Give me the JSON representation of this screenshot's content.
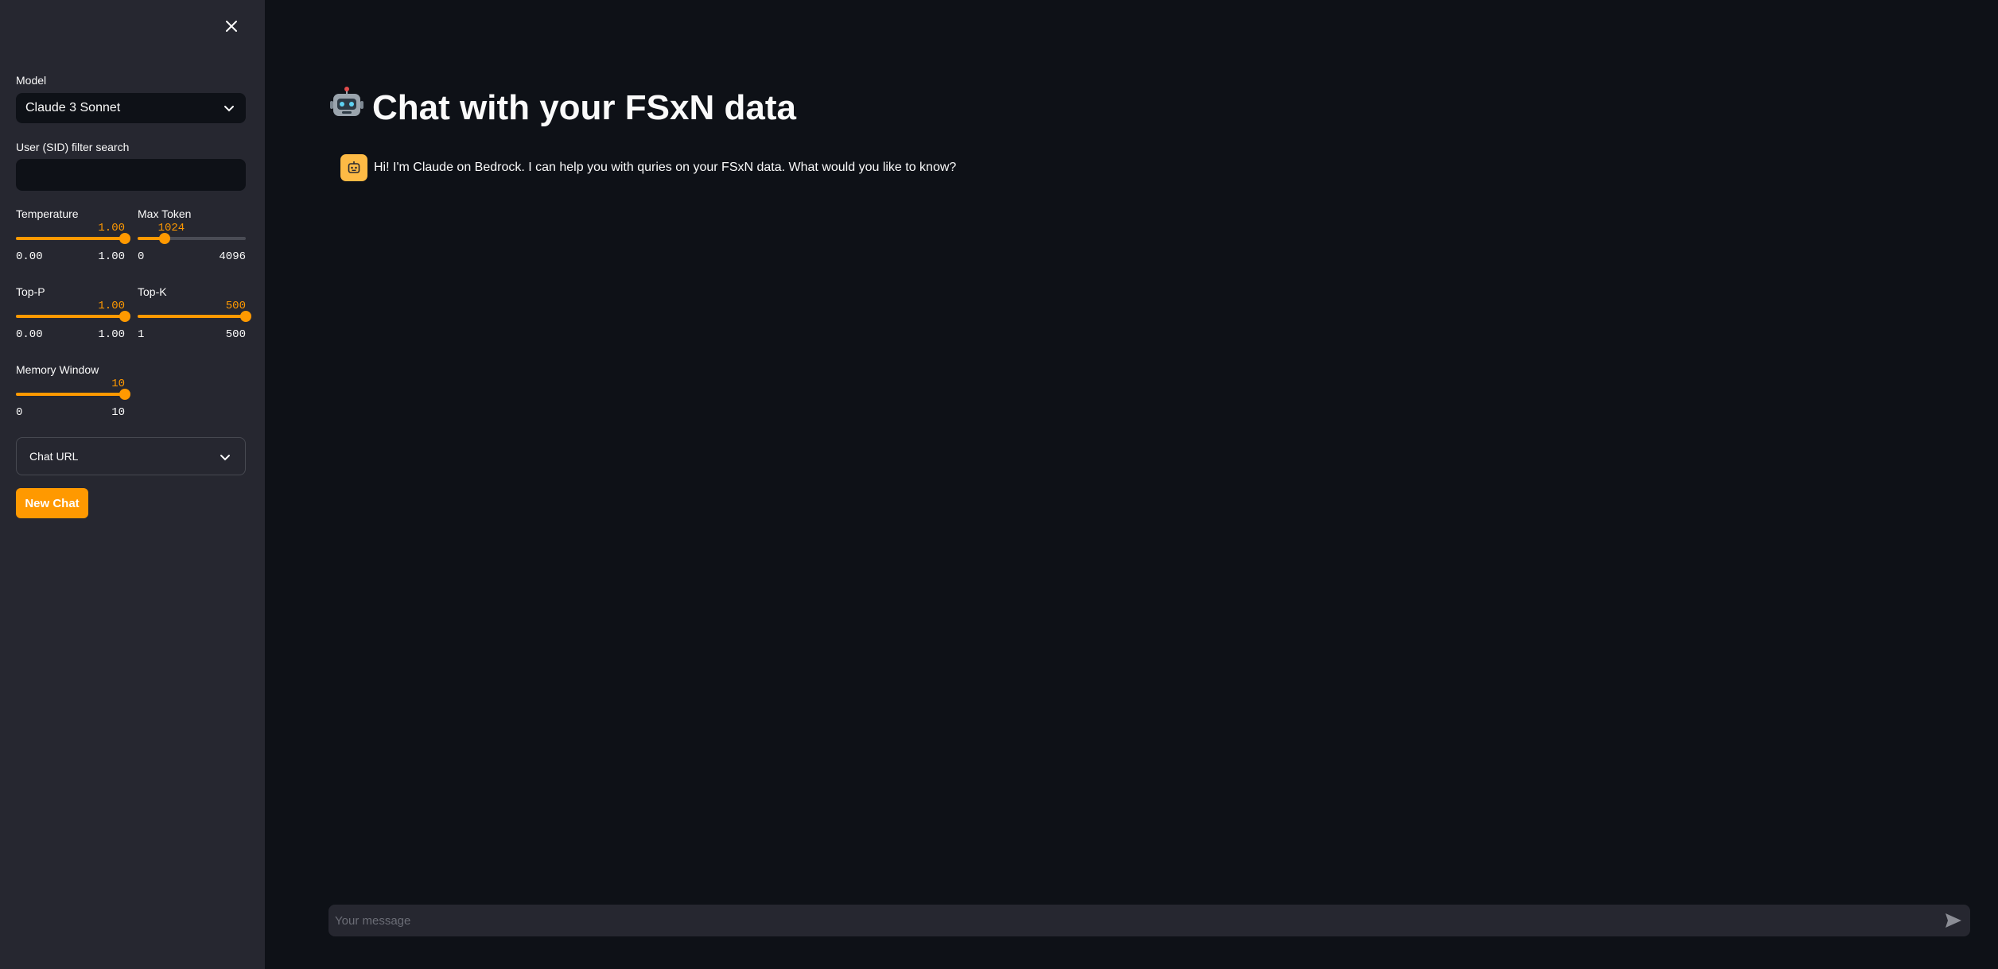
{
  "sidebar": {
    "model": {
      "label": "Model",
      "value": "Claude 3 Sonnet"
    },
    "sid_search": {
      "label": "User (SID) filter search",
      "value": "",
      "placeholder": ""
    },
    "temperature": {
      "label": "Temperature",
      "value": "1.00",
      "min": "0.00",
      "max": "1.00",
      "fraction": 1.0
    },
    "max_token": {
      "label": "Max Token",
      "value": "1024",
      "min": "0",
      "max": "4096",
      "fraction": 0.25
    },
    "top_p": {
      "label": "Top-P",
      "value": "1.00",
      "min": "0.00",
      "max": "1.00",
      "fraction": 1.0
    },
    "top_k": {
      "label": "Top-K",
      "value": "500",
      "min": "1",
      "max": "500",
      "fraction": 1.0
    },
    "memory_window": {
      "label": "Memory Window",
      "value": "10",
      "min": "0",
      "max": "10",
      "fraction": 1.0
    },
    "chat_url_label": "Chat URL",
    "new_chat_label": "New Chat"
  },
  "main": {
    "title": "Chat with your FSxN data",
    "messages": [
      {
        "role": "assistant",
        "text": "Hi! I'm Claude on Bedrock. I can help you with quries on your FSxN data. What would you like to know?"
      }
    ],
    "chat_input_placeholder": "Your message"
  },
  "colors": {
    "accent": "#ff9900",
    "background": "#0e1117",
    "sidebar": "#262730",
    "avatar": "#fdba45"
  },
  "icons": [
    "close-icon",
    "chevron-down-icon",
    "robot-icon",
    "bot-avatar-icon",
    "send-icon"
  ]
}
